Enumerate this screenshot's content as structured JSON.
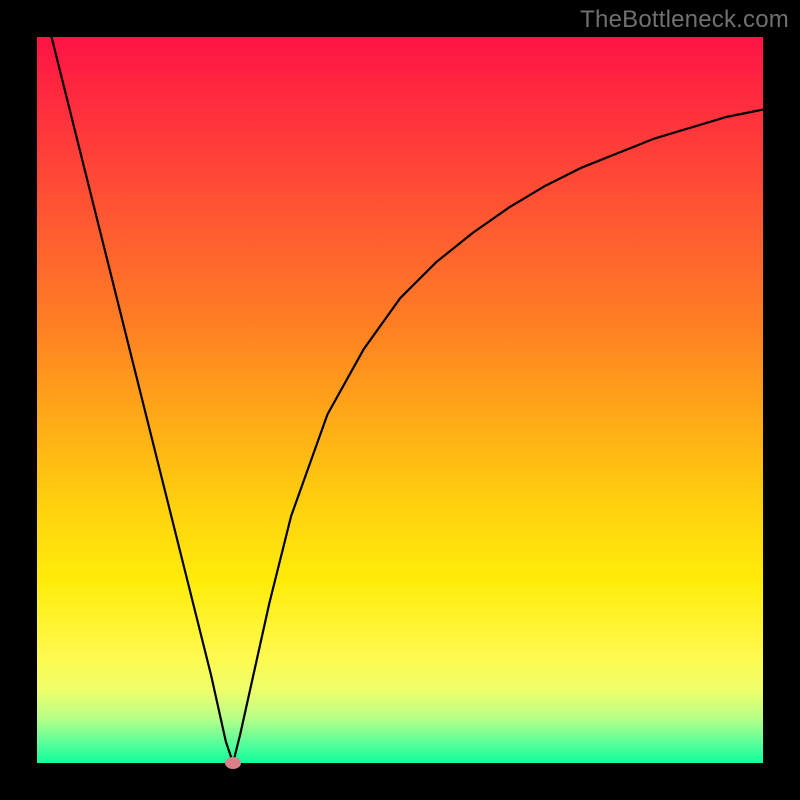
{
  "watermark": "TheBottleneck.com",
  "chart_data": {
    "type": "line",
    "title": "",
    "xlabel": "",
    "ylabel": "",
    "xlim": [
      0,
      100
    ],
    "ylim": [
      0,
      100
    ],
    "series": [
      {
        "name": "curve",
        "x": [
          0,
          3,
          6,
          9,
          12,
          15,
          18,
          21,
          24,
          26,
          27,
          28,
          30,
          32,
          35,
          40,
          45,
          50,
          55,
          60,
          65,
          70,
          75,
          80,
          85,
          90,
          95,
          100
        ],
        "values": [
          108,
          96,
          84,
          72,
          60,
          48,
          36,
          24,
          12,
          3,
          0,
          4,
          13,
          22,
          34,
          48,
          57,
          64,
          69,
          73,
          76.5,
          79.5,
          82,
          84,
          86,
          87.5,
          89,
          90
        ]
      }
    ],
    "markers": [
      {
        "name": "min-point",
        "x": 27,
        "y": 0
      }
    ],
    "grid": false
  }
}
